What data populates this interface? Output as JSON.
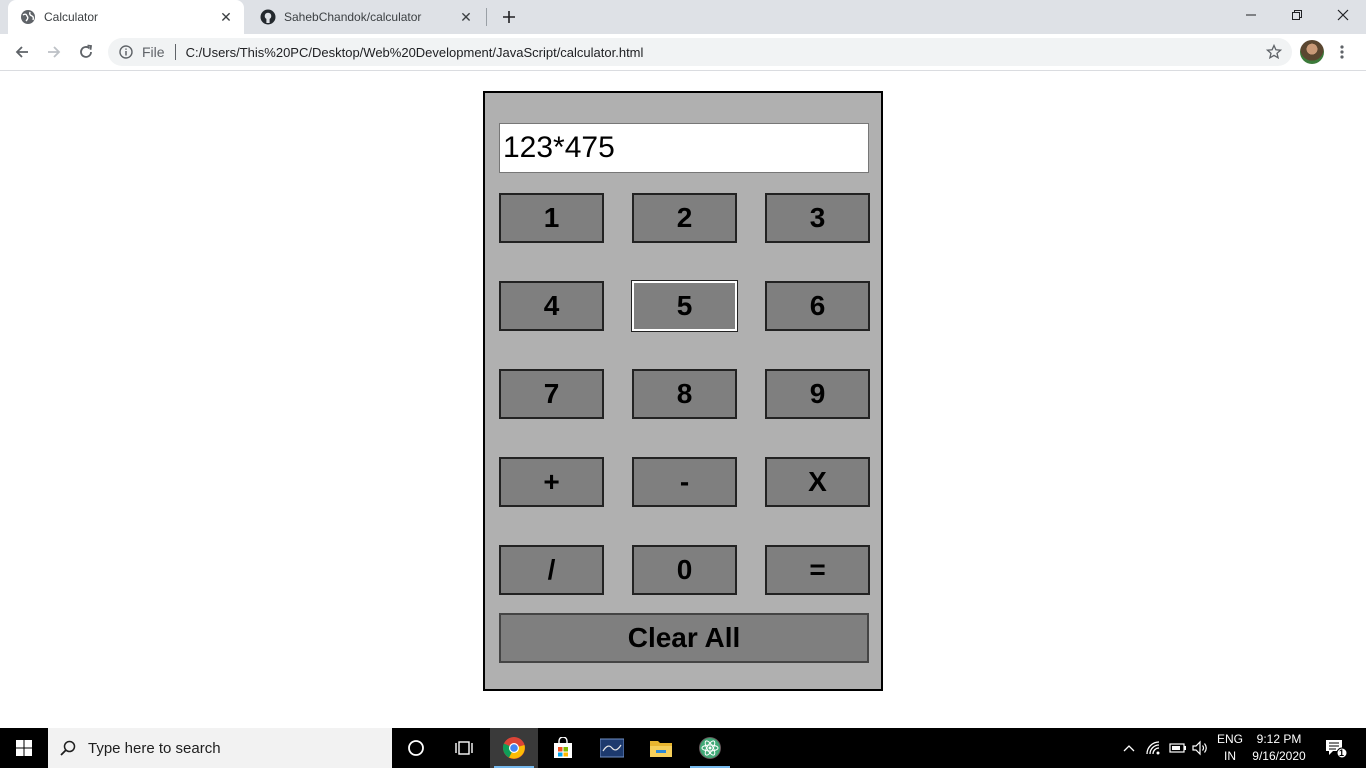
{
  "browser": {
    "tabs": [
      {
        "title": "Calculator",
        "icon": "globe-icon",
        "active": true
      },
      {
        "title": "SahebChandok/calculator",
        "icon": "github-icon",
        "active": false
      }
    ],
    "address": {
      "scheme_label": "File",
      "url": "C:/Users/This%20PC/Desktop/Web%20Development/JavaScript/calculator.html"
    }
  },
  "calculator": {
    "display_value": "123*475",
    "keys": [
      [
        "1",
        "2",
        "3"
      ],
      [
        "4",
        "5",
        "6"
      ],
      [
        "7",
        "8",
        "9"
      ],
      [
        "+",
        "-",
        "X"
      ],
      [
        "/",
        "0",
        "="
      ]
    ],
    "focused_key": "5",
    "clear_label": "Clear All"
  },
  "taskbar": {
    "search_placeholder": "Type here to search",
    "language_line1": "ENG",
    "language_line2": "IN",
    "time": "9:12 PM",
    "date": "9/16/2020",
    "notification_count": "1"
  }
}
